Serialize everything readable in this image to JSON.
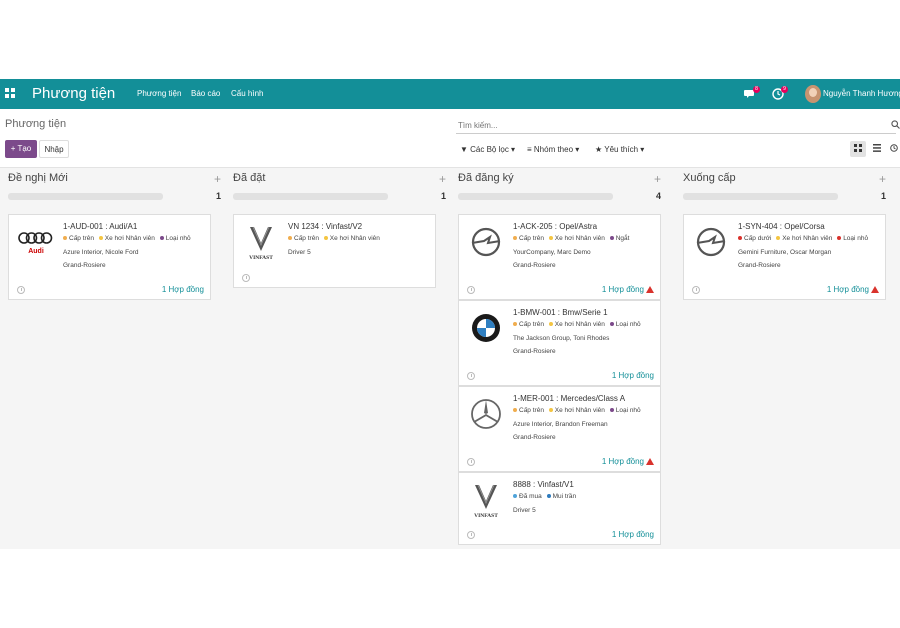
{
  "navbar": {
    "app_title": "Phương tiện",
    "menu": [
      "Phương tiện",
      "Báo cáo",
      "Cấu hình"
    ],
    "chat_badge": "8",
    "activity_badge": "9",
    "user_name": "Nguyễn Thanh Hương"
  },
  "control": {
    "breadcrumb": "Phương tiện",
    "create_label": "+ Tạo",
    "import_label": "Nhập",
    "search_placeholder": "Tìm kiếm...",
    "filters_label": "▼ Các Bộ lọc ▾",
    "groupby_label": "≡ Nhóm theo ▾",
    "favorites_label": "★ Yêu thích ▾"
  },
  "colors": {
    "navbar": "#138f98",
    "create_button": "#7c4a8b",
    "tag_orange": "#f0ad4e",
    "tag_yellow": "#f4c542",
    "tag_red": "#d9322c",
    "tag_purple": "#7c4a8b",
    "tag_blue": "#4fa3d9",
    "warning": "#d9322c"
  },
  "columns": [
    {
      "title": "Đề nghị Mới",
      "count": "1",
      "cards": [
        {
          "logo": "audi-logo",
          "name": "1-AUD-001 : Audi/A1",
          "tags": [
            {
              "label": "Cấp trên",
              "color": "#f0ad4e"
            },
            {
              "label": "Xe hơi Nhân viên",
              "color": "#f4c542"
            },
            {
              "label": "Loại nhỏ",
              "color": "#7c4a8b"
            }
          ],
          "line1": "Azure Interior, Nicole Ford",
          "line2": "Grand-Rosiere",
          "contract": "1 Hợp đồng",
          "warning": false
        }
      ]
    },
    {
      "title": "Đã đặt",
      "count": "1",
      "cards": [
        {
          "logo": "vinfast-logo",
          "name": "VN 1234 : Vinfast/V2",
          "tags": [
            {
              "label": "Cấp trên",
              "color": "#f0ad4e"
            },
            {
              "label": "Xe hơi Nhân viên",
              "color": "#f4c542"
            }
          ],
          "line1": "Driver 5",
          "line2": "",
          "contract": "",
          "warning": false
        }
      ]
    },
    {
      "title": "Đã đăng ký",
      "count": "4",
      "cards": [
        {
          "logo": "opel-logo",
          "name": "1-ACK-205 : Opel/Astra",
          "tags": [
            {
              "label": "Cấp trên",
              "color": "#f0ad4e"
            },
            {
              "label": "Xe hơi Nhân viên",
              "color": "#f4c542"
            },
            {
              "label": "Ngắt",
              "color": "#7c4a8b"
            }
          ],
          "line1": "YourCompany, Marc Demo",
          "line2": "Grand-Rosiere",
          "contract": "1 Hợp đồng",
          "warning": true
        },
        {
          "logo": "bmw-logo",
          "name": "1-BMW-001 : Bmw/Serie 1",
          "tags": [
            {
              "label": "Cấp trên",
              "color": "#f0ad4e"
            },
            {
              "label": "Xe hơi Nhân viên",
              "color": "#f4c542"
            },
            {
              "label": "Loại nhỏ",
              "color": "#7c4a8b"
            }
          ],
          "line1": "The Jackson Group, Toni Rhodes",
          "line2": "Grand-Rosiere",
          "contract": "1 Hợp đồng",
          "warning": false
        },
        {
          "logo": "mercedes-logo",
          "name": "1-MER-001 : Mercedes/Class A",
          "tags": [
            {
              "label": "Cấp trên",
              "color": "#f0ad4e"
            },
            {
              "label": "Xe hơi Nhân viên",
              "color": "#f4c542"
            },
            {
              "label": "Loại nhỏ",
              "color": "#7c4a8b"
            }
          ],
          "line1": "Azure Interior, Brandon Freeman",
          "line2": "Grand-Rosiere",
          "contract": "1 Hợp đồng",
          "warning": true
        },
        {
          "logo": "vinfast-logo",
          "name": "8888 : Vinfast/V1",
          "tags": [
            {
              "label": "Đã mua",
              "color": "#4fa3d9"
            },
            {
              "label": "Mui trần",
              "color": "#2e7bbd"
            }
          ],
          "line1": "Driver 5",
          "line2": "",
          "contract": "1 Hợp đồng",
          "warning": false
        }
      ]
    },
    {
      "title": "Xuống cấp",
      "count": "1",
      "cards": [
        {
          "logo": "opel-logo",
          "name": "1-SYN-404 : Opel/Corsa",
          "tags": [
            {
              "label": "Cấp dưới",
              "color": "#d9322c"
            },
            {
              "label": "Xe hơi Nhân viên",
              "color": "#f4c542"
            },
            {
              "label": "Loại nhỏ",
              "color": "#d9322c"
            }
          ],
          "line1": "Gemini Furniture, Oscar Morgan",
          "line2": "Grand-Rosiere",
          "contract": "1 Hợp đồng",
          "warning": true
        }
      ]
    }
  ]
}
